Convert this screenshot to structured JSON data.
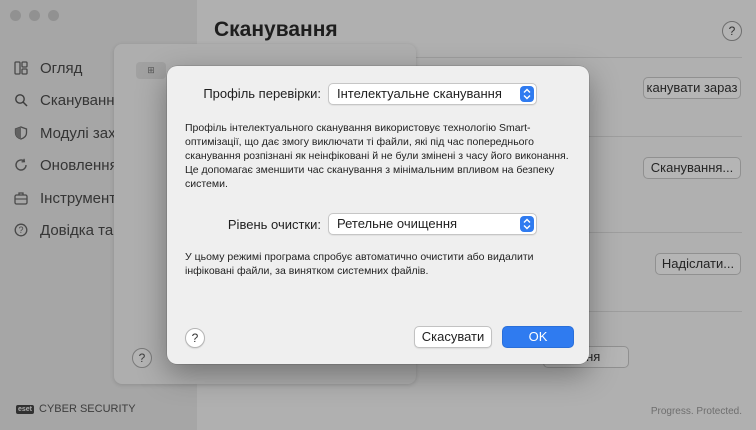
{
  "sidebar": {
    "items": [
      {
        "label": "Огляд",
        "icon": "overview-icon"
      },
      {
        "label": "Сканування",
        "icon": "search-icon"
      },
      {
        "label": "Модулі захи",
        "icon": "shield-icon"
      },
      {
        "label": "Оновлення",
        "icon": "refresh-icon"
      },
      {
        "label": "Інструменти",
        "icon": "toolbox-icon"
      },
      {
        "label": "Довідка та п",
        "icon": "help-icon"
      }
    ],
    "brand_badge": "eset",
    "brand_text": "CYBER SECURITY"
  },
  "main": {
    "title": "Сканування",
    "help": "?",
    "scan_now_label": "канувати зараз",
    "scans_label": "Сканування...",
    "send_label": "Надіслати...",
    "hidden_btn_label": "ання",
    "footer": "Progress. Protected."
  },
  "back_sheet": {
    "grid_icon": "⊞",
    "help": "?"
  },
  "dialog": {
    "profile_label": "Профіль перевірки:",
    "profile_value": "Інтелектуальне сканування",
    "profile_desc": "Профіль інтелектуального сканування використовує технологію Smart-оптимізації, що дає змогу виключати ті файли, які під час попереднього сканування розпізнані як неінфіковані й не були змінені з часу його виконання. Це допомагає зменшити час сканування з мінімальним впливом на безпеку системи.",
    "clean_label": "Рівень очистки:",
    "clean_value": "Ретельне очищення",
    "clean_desc": "У цьому режимі програма спробує автоматично очистити або видалити інфіковані файли, за винятком системних файлів.",
    "help": "?",
    "cancel_label": "Скасувати",
    "ok_label": "OK"
  },
  "colors": {
    "accent": "#2f7bf0"
  }
}
